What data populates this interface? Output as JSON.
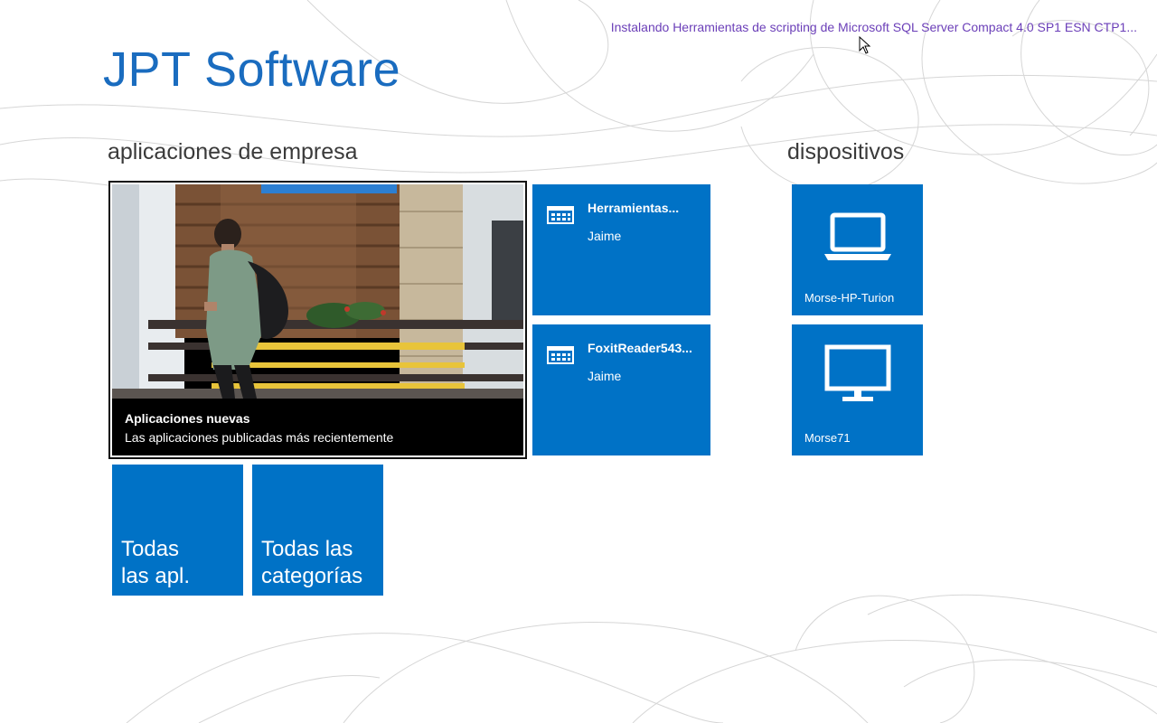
{
  "status": {
    "text": "Instalando Herramientas de scripting  de Microsoft SQL Server Compact 4.0 SP1  ESN CTP1..."
  },
  "app_title": "JPT Software",
  "sections": {
    "apps_heading": "aplicaciones de empresa",
    "devices_heading": "dispositivos"
  },
  "hero": {
    "title": "Aplicaciones nuevas",
    "subtitle": "Las aplicaciones publicadas más recientemente"
  },
  "apps": [
    {
      "name": "Herramientas...",
      "user": "Jaime",
      "icon": "app-grid-icon"
    },
    {
      "name": "FoxitReader543...",
      "user": "Jaime",
      "icon": "app-grid-icon"
    }
  ],
  "nav_tiles": {
    "all_apps": "Todas\nlas apl.",
    "all_categories": "Todas las\ncategorías"
  },
  "devices": [
    {
      "name": "Morse-HP-Turion",
      "icon": "laptop-icon"
    },
    {
      "name": "Morse71",
      "icon": "monitor-icon"
    }
  ],
  "colors": {
    "tile": "#0072c6",
    "title": "#1a6cbf",
    "status": "#6b3fb8"
  }
}
